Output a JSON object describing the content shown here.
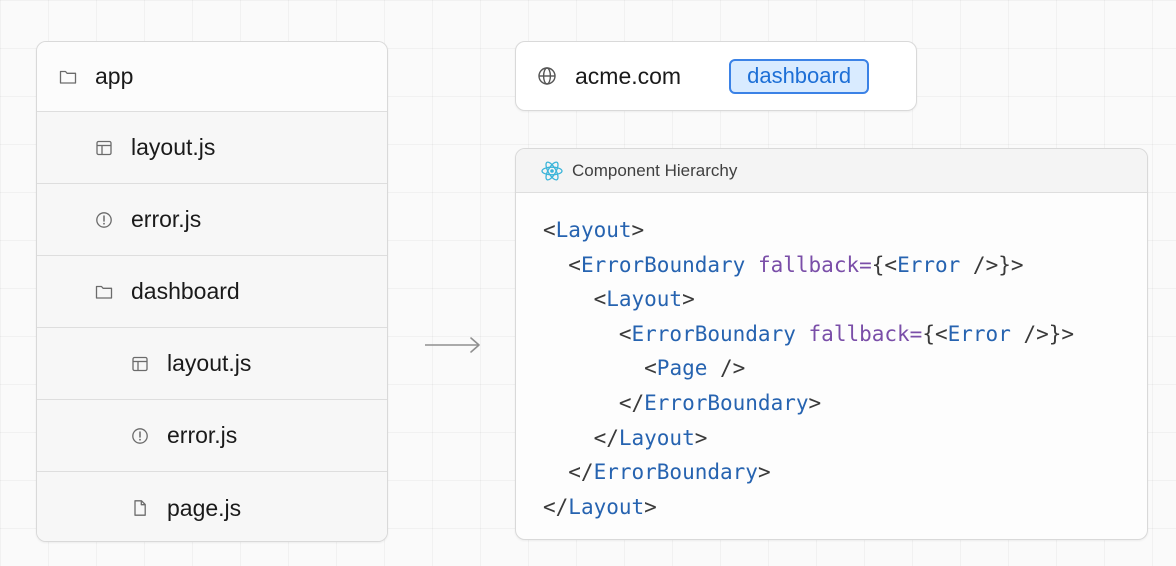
{
  "file_tree": [
    {
      "label": "app",
      "icon": "folder-icon",
      "depth": 0
    },
    {
      "label": "layout.js",
      "icon": "layout-file-icon",
      "depth": 1
    },
    {
      "label": "error.js",
      "icon": "error-file-icon",
      "depth": 1
    },
    {
      "label": "dashboard",
      "icon": "folder-icon",
      "depth": 1
    },
    {
      "label": "layout.js",
      "icon": "layout-file-icon",
      "depth": 2
    },
    {
      "label": "error.js",
      "icon": "error-file-icon",
      "depth": 2
    },
    {
      "label": "page.js",
      "icon": "page-file-icon",
      "depth": 2
    }
  ],
  "url_bar": {
    "domain": "acme.com",
    "active_segment": "dashboard"
  },
  "component_panel": {
    "title": "Component Hierarchy",
    "code_lines": [
      {
        "indent": 0,
        "tokens": [
          [
            "punct",
            "<"
          ],
          [
            "tag",
            "Layout"
          ],
          [
            "punct",
            ">"
          ]
        ]
      },
      {
        "indent": 1,
        "tokens": [
          [
            "punct",
            "<"
          ],
          [
            "tag",
            "ErrorBoundary"
          ],
          [
            "punct",
            " "
          ],
          [
            "attr",
            "fallback="
          ],
          [
            "punct",
            "{<"
          ],
          [
            "tag",
            "Error"
          ],
          [
            "punct",
            " />}>"
          ]
        ]
      },
      {
        "indent": 2,
        "tokens": [
          [
            "punct",
            "<"
          ],
          [
            "tag",
            "Layout"
          ],
          [
            "punct",
            ">"
          ]
        ]
      },
      {
        "indent": 3,
        "tokens": [
          [
            "punct",
            "<"
          ],
          [
            "tag",
            "ErrorBoundary"
          ],
          [
            "punct",
            " "
          ],
          [
            "attr",
            "fallback="
          ],
          [
            "punct",
            "{<"
          ],
          [
            "tag",
            "Error"
          ],
          [
            "punct",
            " />}>"
          ]
        ]
      },
      {
        "indent": 4,
        "tokens": [
          [
            "punct",
            "<"
          ],
          [
            "tag",
            "Page"
          ],
          [
            "punct",
            " />"
          ]
        ]
      },
      {
        "indent": 3,
        "tokens": [
          [
            "punct",
            "</"
          ],
          [
            "tag",
            "ErrorBoundary"
          ],
          [
            "punct",
            ">"
          ]
        ]
      },
      {
        "indent": 2,
        "tokens": [
          [
            "punct",
            "</"
          ],
          [
            "tag",
            "Layout"
          ],
          [
            "punct",
            ">"
          ]
        ]
      },
      {
        "indent": 1,
        "tokens": [
          [
            "punct",
            "</"
          ],
          [
            "tag",
            "ErrorBoundary"
          ],
          [
            "punct",
            ">"
          ]
        ]
      },
      {
        "indent": 0,
        "tokens": [
          [
            "punct",
            "</"
          ],
          [
            "tag",
            "Layout"
          ],
          [
            "punct",
            ">"
          ]
        ]
      }
    ]
  },
  "colors": {
    "tag": "#2663b0",
    "attr": "#7a4ea8",
    "segment_fill": "#d9ebff",
    "segment_border": "#3b82e6",
    "react_icon": "#3ab4d9"
  }
}
